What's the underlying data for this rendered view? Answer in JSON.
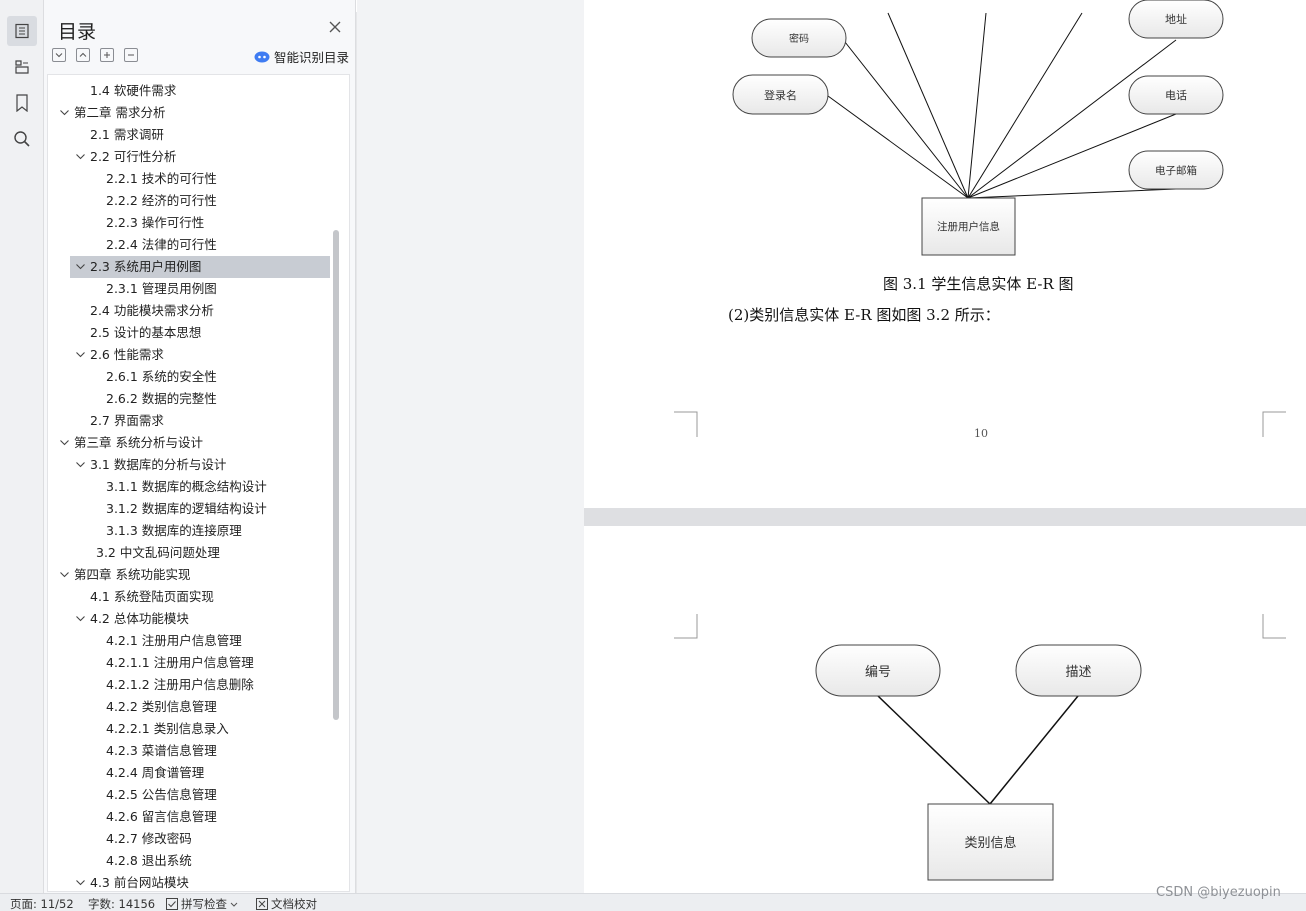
{
  "toc": {
    "title": "目录",
    "smart_label": "智能识别目录",
    "items": [
      {
        "label": "1.4 软硬件需求",
        "level": 1,
        "chevron": false,
        "selected": false
      },
      {
        "label": "第二章  需求分析",
        "level": 0,
        "chevron": true,
        "selected": false
      },
      {
        "label": "2.1 需求调研",
        "level": 1,
        "chevron": false,
        "selected": false
      },
      {
        "label": "2.2 可行性分析",
        "level": 1,
        "chevron": true,
        "selected": false
      },
      {
        "label": "2.2.1 技术的可行性",
        "level": 2,
        "chevron": false,
        "selected": false
      },
      {
        "label": "2.2.2 经济的可行性",
        "level": 2,
        "chevron": false,
        "selected": false
      },
      {
        "label": "2.2.3 操作可行性",
        "level": 2,
        "chevron": false,
        "selected": false
      },
      {
        "label": "2.2.4 法律的可行性",
        "level": 2,
        "chevron": false,
        "selected": false
      },
      {
        "label": "2.3 系统用户用例图",
        "level": 1,
        "chevron": true,
        "selected": true
      },
      {
        "label": "2.3.1 管理员用例图",
        "level": 2,
        "chevron": false,
        "selected": false
      },
      {
        "label": "2.4 功能模块需求分析",
        "level": 1,
        "chevron": false,
        "selected": false
      },
      {
        "label": "2.5 设计的基本思想",
        "level": 1,
        "chevron": false,
        "selected": false
      },
      {
        "label": "2.6 性能需求",
        "level": 1,
        "chevron": true,
        "selected": false
      },
      {
        "label": "2.6.1 系统的安全性",
        "level": 2,
        "chevron": false,
        "selected": false
      },
      {
        "label": "2.6.2 数据的完整性",
        "level": 2,
        "chevron": false,
        "selected": false
      },
      {
        "label": "2.7 界面需求",
        "level": 1,
        "chevron": false,
        "selected": false
      },
      {
        "label": "第三章  系统分析与设计",
        "level": 0,
        "chevron": true,
        "selected": false
      },
      {
        "label": "3.1 数据库的分析与设计",
        "level": 1,
        "chevron": true,
        "selected": false
      },
      {
        "label": "3.1.1 数据库的概念结构设计",
        "level": 2,
        "chevron": false,
        "selected": false
      },
      {
        "label": "3.1.2 数据库的逻辑结构设计",
        "level": 2,
        "chevron": false,
        "selected": false
      },
      {
        "label": "3.1.3 数据库的连接原理",
        "level": 2,
        "chevron": false,
        "selected": false
      },
      {
        "label": "3.2 中文乱码问题处理",
        "level": 1.4,
        "chevron": false,
        "selected": false
      },
      {
        "label": "第四章  系统功能实现",
        "level": 0,
        "chevron": true,
        "selected": false
      },
      {
        "label": "4.1 系统登陆页面实现",
        "level": 1,
        "chevron": false,
        "selected": false
      },
      {
        "label": "4.2 总体功能模块",
        "level": 1,
        "chevron": true,
        "selected": false
      },
      {
        "label": "4.2.1 注册用户信息管理",
        "level": 2,
        "chevron": false,
        "selected": false
      },
      {
        "label": "4.2.1.1 注册用户信息管理",
        "level": 2,
        "chevron": false,
        "selected": false
      },
      {
        "label": "4.2.1.2 注册用户信息删除",
        "level": 2,
        "chevron": false,
        "selected": false
      },
      {
        "label": "4.2.2 类别信息管理",
        "level": 2,
        "chevron": false,
        "selected": false
      },
      {
        "label": "4.2.2.1 类别信息录入",
        "level": 2,
        "chevron": false,
        "selected": false
      },
      {
        "label": "4.2.3 菜谱信息管理",
        "level": 2,
        "chevron": false,
        "selected": false
      },
      {
        "label": "4.2.4 周食谱管理",
        "level": 2,
        "chevron": false,
        "selected": false
      },
      {
        "label": "4.2.5 公告信息管理",
        "level": 2,
        "chevron": false,
        "selected": false
      },
      {
        "label": "4.2.6 留言信息管理",
        "level": 2,
        "chevron": false,
        "selected": false
      },
      {
        "label": "4.2.7 修改密码",
        "level": 2,
        "chevron": false,
        "selected": false
      },
      {
        "label": "4.2.8 退出系统",
        "level": 2,
        "chevron": false,
        "selected": false
      },
      {
        "label": "4.3 前台网站模块",
        "level": 1,
        "chevron": true,
        "selected": false
      }
    ]
  },
  "page1": {
    "entities": {
      "password": "密码",
      "login_name": "登录名",
      "address": "地址",
      "phone": "电话",
      "email": "电子邮箱",
      "center": "注册用户信息"
    },
    "figure_caption": "图 3.1  学生信息实体 E-R 图",
    "paragraph": "(2)类别信息实体 E-R 图如图 3.2 所示：",
    "page_number": "10"
  },
  "page2": {
    "entities": {
      "id": "编号",
      "desc": "描述",
      "center": "类别信息"
    }
  },
  "status": {
    "page": "页面: 11/52",
    "words": "字数: 14156",
    "spell": "拼写检查",
    "proof": "文档校对"
  },
  "watermark": "CSDN @biyezuopin"
}
